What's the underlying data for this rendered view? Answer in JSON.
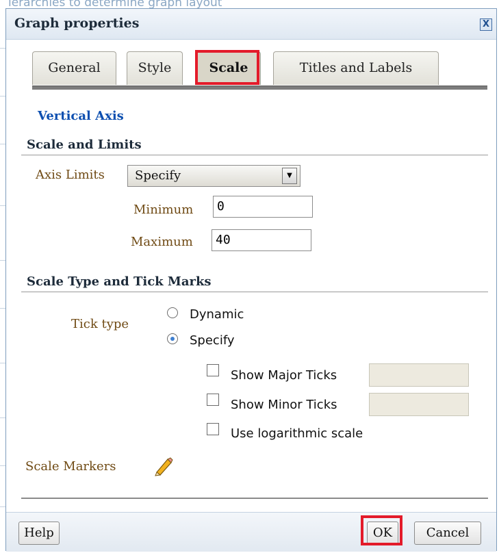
{
  "background": {
    "text": "ierarchies to determine graph layout"
  },
  "dialog": {
    "title": "Graph properties",
    "close_label": "X"
  },
  "tabs": [
    {
      "label": "General",
      "active": false
    },
    {
      "label": "Style",
      "active": false
    },
    {
      "label": "Scale",
      "active": true
    },
    {
      "label": "Titles and Labels",
      "active": false
    }
  ],
  "vertical_axis": {
    "heading": "Vertical Axis"
  },
  "scale_limits": {
    "heading": "Scale and Limits",
    "axis_limits_label": "Axis Limits",
    "axis_limits_value": "Specify",
    "minimum_label": "Minimum",
    "minimum_value": "0",
    "maximum_label": "Maximum",
    "maximum_value": "40"
  },
  "scale_type": {
    "heading": "Scale Type and Tick Marks",
    "tick_type_label": "Tick type",
    "radio_dynamic": "Dynamic",
    "radio_specify": "Specify",
    "selected": "Specify",
    "show_major_ticks": "Show Major Ticks",
    "show_minor_ticks": "Show Minor Ticks",
    "use_log_scale": "Use logarithmic scale"
  },
  "scale_markers": {
    "label": "Scale Markers",
    "icon": "pencil-icon"
  },
  "footer": {
    "help_label": "Help",
    "ok_label": "OK",
    "cancel_label": "Cancel"
  },
  "colors": {
    "highlight": "#e31b2a",
    "link_blue": "#0d4fb0",
    "label_brown": "#6f4a14"
  }
}
